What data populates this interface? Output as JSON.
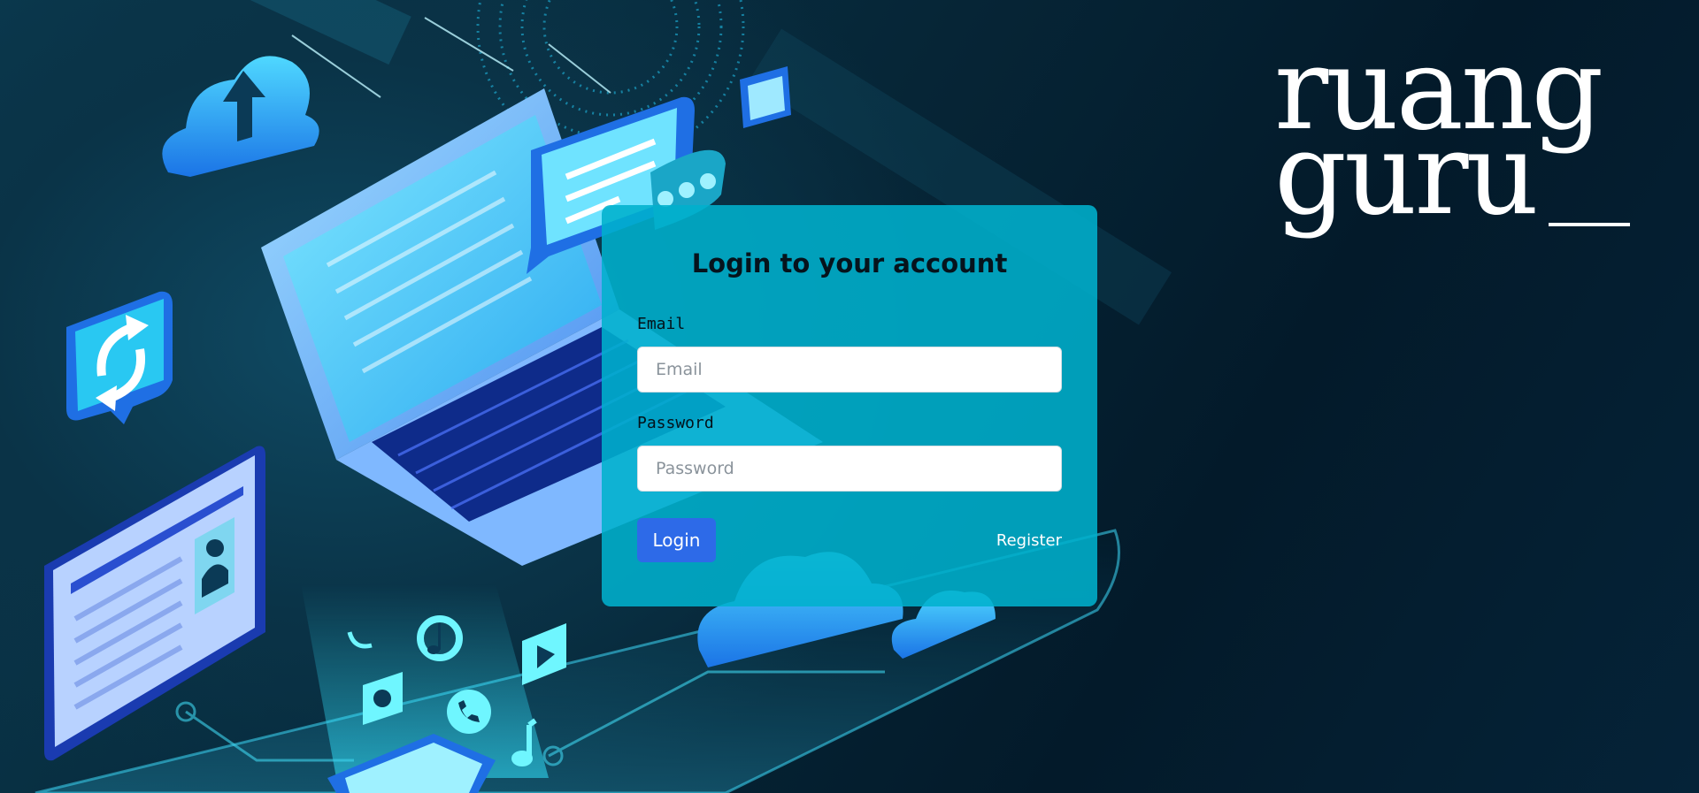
{
  "brand": {
    "logo_line1": "ruang",
    "logo_line2": "guru"
  },
  "login_card": {
    "title": "Login to your account",
    "email": {
      "label": "Email",
      "placeholder": "Email",
      "value": ""
    },
    "password": {
      "label": "Password",
      "placeholder": "Password",
      "value": ""
    },
    "login_button_label": "Login",
    "register_link_label": "Register"
  },
  "colors": {
    "card_background": "#00b0cd",
    "login_button": "#2d6ae8",
    "page_background": "#062536"
  },
  "illustration_icons": [
    "cloud-upload-icon",
    "laptop-icon",
    "chat-bubble-icon",
    "folder-icon",
    "sync-icon",
    "tablet-icon",
    "phone-icon",
    "music-note-icon",
    "play-icon",
    "camera-icon",
    "call-icon",
    "cloud-icon"
  ]
}
